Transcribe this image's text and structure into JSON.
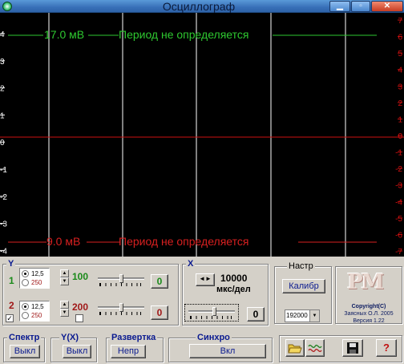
{
  "window": {
    "title": "Осциллограф",
    "minimize": "▁",
    "maximize": "▫",
    "close": "✕"
  },
  "scope": {
    "left_axis": [
      "4",
      "3",
      "2",
      "1",
      "0",
      "-1",
      "-2",
      "-3",
      "-4"
    ],
    "right_axis": [
      "7",
      "6",
      "5",
      "4",
      "3",
      "2",
      "1",
      "0",
      "-1",
      "-2",
      "-3",
      "-4",
      "-5",
      "-6",
      "-7"
    ],
    "ch1_voltage": "17.0 мВ",
    "ch1_period": "Период не определяется",
    "ch2_voltage": "9.0 мВ",
    "ch2_period": "Период не определяется",
    "colors": {
      "grid": "#ffffff",
      "trace": "#cc1010",
      "ch1": "#2ec830",
      "ch2": "#d82020"
    }
  },
  "y": {
    "title": "Y",
    "ch1": {
      "num": "1",
      "opt_a": "12,5",
      "opt_b": "250",
      "gain": "100",
      "zero": "0"
    },
    "ch2": {
      "num": "2",
      "opt_a": "12,5",
      "opt_b": "250",
      "gain": "200",
      "zero": "0",
      "check": "✓"
    }
  },
  "x": {
    "title": "X",
    "value": "10000",
    "unit": "мкс/дел",
    "zero": "0"
  },
  "settings": {
    "title": "Настр",
    "calibrate": "Калибр",
    "rate": "192000"
  },
  "about": {
    "logo": "PM",
    "line1": "Copyright(C)",
    "line2": "Заясных О.Л. 2005",
    "line3": "Версия 1.22"
  },
  "spectrum": {
    "title": "Спектр",
    "button": "Выкл"
  },
  "yx": {
    "title": "Y(X)",
    "button": "Выкл"
  },
  "sweep": {
    "title": "Развертка",
    "button": "Непр"
  },
  "sync": {
    "title": "Синхро",
    "button": "Вкл"
  },
  "tools": {
    "help": "?"
  }
}
